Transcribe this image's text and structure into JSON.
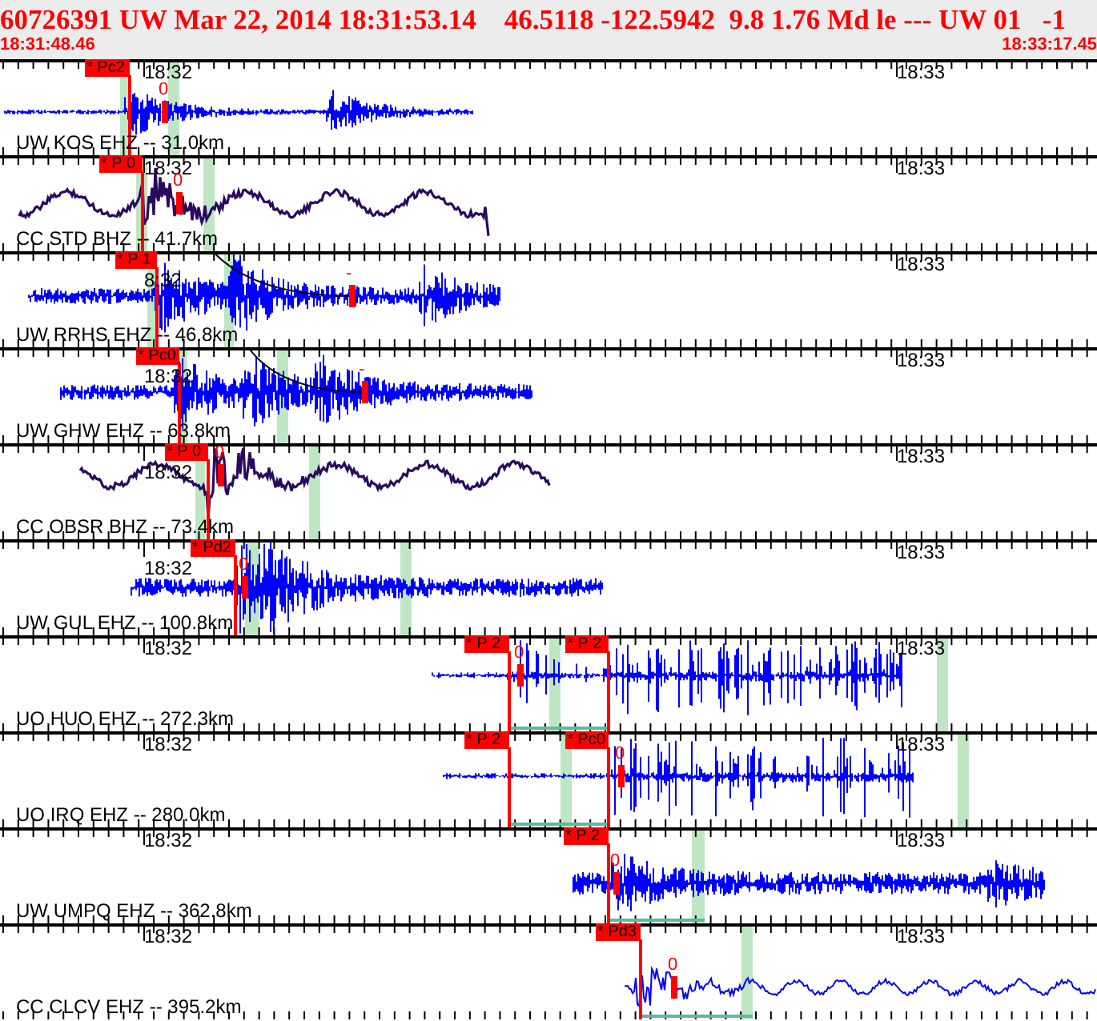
{
  "header": {
    "title": "60726391 UW Mar 22, 2014 18:31:53.14    46.5118 -122.5942  9.8 1.76 Md le --- UW 01   -1",
    "start_time": "18:31:48.46",
    "end_time": "18:33:17.45"
  },
  "channels": [
    {
      "label": "UW KOS EHZ -- 31.0km",
      "color": "#0000ff",
      "kind": "noisy",
      "time_labels": [
        "18:32",
        "18:33"
      ],
      "picks": [
        "* Pc2"
      ],
      "amp_mark": "0"
    },
    {
      "label": "CC STD BHZ -- 41.7km",
      "color": "#2a0a5e",
      "kind": "smooth",
      "time_labels": [
        "18:32",
        "18:33"
      ],
      "picks": [
        "* P 0"
      ],
      "amp_mark": "0"
    },
    {
      "label": "UW RRHS EHZ -- 46.8km",
      "color": "#0000ff",
      "kind": "noisy",
      "time_labels": [
        "8:32",
        "18:33"
      ],
      "picks": [
        "* P 1"
      ],
      "amp_mark": "-"
    },
    {
      "label": "UW GHW EHZ -- 63.8km",
      "color": "#0000ff",
      "kind": "noisy",
      "time_labels": [
        "18:32",
        "18:33"
      ],
      "picks": [
        "* Pc0"
      ],
      "amp_mark": "-"
    },
    {
      "label": "CC OBSR BHZ -- 73.4km",
      "color": "#2a0a5e",
      "kind": "smooth",
      "time_labels": [
        "18:32",
        "18:33"
      ],
      "picks": [
        "* P 0"
      ],
      "amp_mark": "0"
    },
    {
      "label": "UW GUL EHZ -- 100.8km",
      "color": "#0000ff",
      "kind": "noisy",
      "time_labels": [
        "18:32",
        "18:33"
      ],
      "picks": [
        "* Pd2"
      ],
      "amp_mark": "0"
    },
    {
      "label": "UO HUO EHZ -- 272.3km",
      "color": "#0000ff",
      "kind": "spiky",
      "time_labels": [
        "18:32",
        "18:33"
      ],
      "picks": [
        "* P 2",
        "* P 2"
      ],
      "amp_mark": "0"
    },
    {
      "label": "UO IRQ EHZ -- 280.0km",
      "color": "#0000ff",
      "kind": "spiky",
      "time_labels": [
        "18:32",
        "18:33"
      ],
      "picks": [
        "* P 2",
        "* Pc0"
      ],
      "amp_mark": "0"
    },
    {
      "label": "UW UMPQ EHZ -- 362.8km",
      "color": "#0000ff",
      "kind": "noisy",
      "time_labels": [
        "18:32",
        "18:33"
      ],
      "picks": [
        "* P 2"
      ],
      "amp_mark": "0"
    },
    {
      "label": "CC CLCV EHZ -- 395.2km",
      "color": "#0000ff",
      "kind": "wavy",
      "time_labels": [
        "18:32",
        "18:33"
      ],
      "picks": [
        "* Pd3"
      ],
      "amp_mark": "0"
    }
  ]
}
